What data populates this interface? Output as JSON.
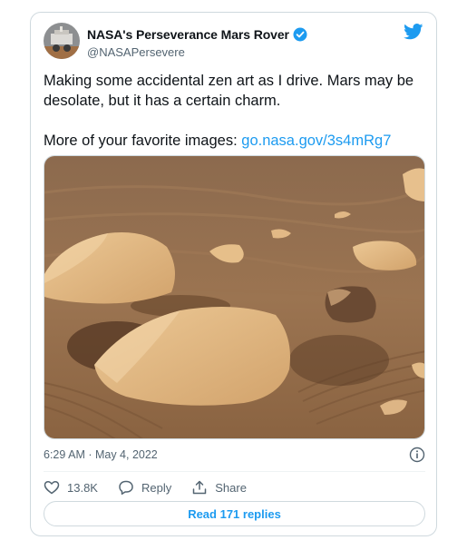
{
  "author": {
    "display_name": "NASA's Perseverance Mars Rover",
    "handle": "@NASAPersevere",
    "verified_icon": "verified-badge-icon",
    "avatar_icon": "rover-avatar"
  },
  "platform_icon": "twitter-bird-icon",
  "tweet": {
    "line1": "Making some accidental zen art as I drive. Mars may be desolate, but it has a certain charm.",
    "line2_prefix": "More of your favorite images: ",
    "link_text": "go.nasa.gov/3s4mRg7"
  },
  "media": {
    "description_icon": "mars-rocks-photo"
  },
  "meta": {
    "timestamp": "6:29 AM · May 4, 2022",
    "info_icon": "info-icon"
  },
  "actions": {
    "like_count": "13.8K",
    "reply_label": "Reply",
    "share_label": "Share"
  },
  "read_replies_label": "Read 171 replies",
  "colors": {
    "accent": "#1d9bf0",
    "text": "#0f1419",
    "muted": "#536471",
    "border": "#cfd9de",
    "sand": "#b98a5e"
  }
}
